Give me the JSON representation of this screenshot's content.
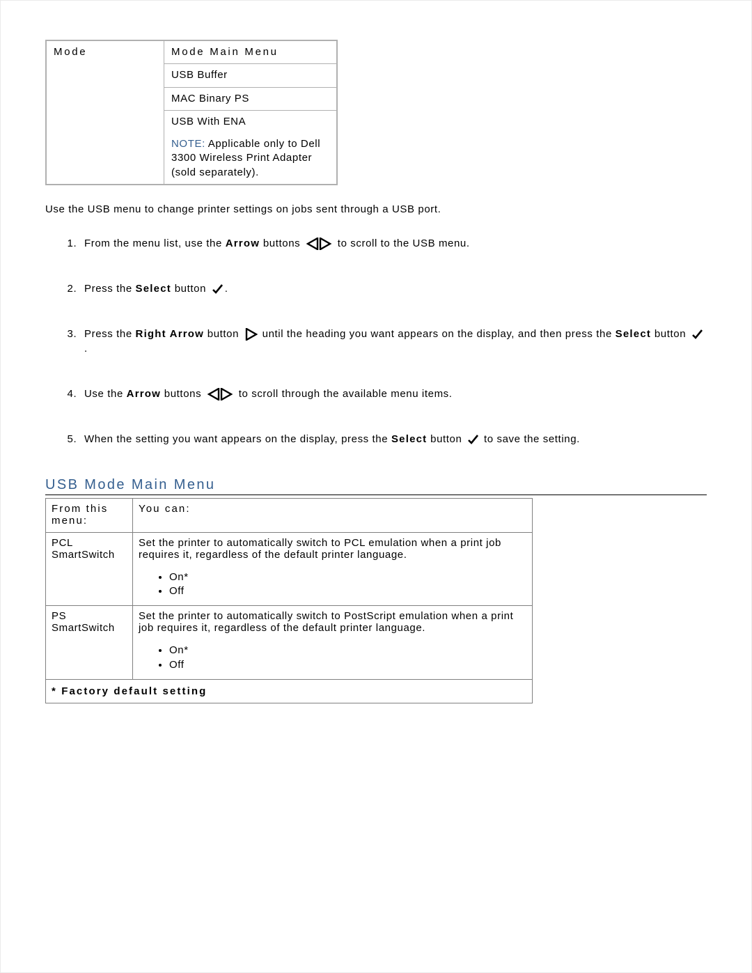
{
  "top_table": {
    "col1_header": "Mode",
    "col2_rows": {
      "r0": "Mode Main Menu",
      "r1": "USB Buffer",
      "r2": "MAC Binary PS",
      "r3_line1": "USB With ENA",
      "r3_note_label": "NOTE:",
      "r3_note_body": "  Applicable only to Dell 3300 Wireless Print Adapter (sold separately)."
    }
  },
  "intro_text": "Use the USB menu to change printer settings on jobs sent through a USB port.",
  "steps": {
    "s1_a": "From the menu list, use the ",
    "s1_bold": "Arrow",
    "s1_b": " buttons ",
    "s1_c": " to scroll to the USB menu.",
    "s2_a": "Press the ",
    "s2_bold": "Select",
    "s2_b": " button ",
    "s2_c": ".",
    "s3_a": "Press the ",
    "s3_bold": "Right Arrow",
    "s3_b": " button ",
    "s3_c": " until the heading you want appears on the display, and then press the ",
    "s3_bold2": "Select",
    "s3_d": " button ",
    "s3_e": ".",
    "s4_a": "Use the ",
    "s4_bold": "Arrow",
    "s4_b": " buttons ",
    "s4_c": " to scroll through the available menu items.",
    "s5_a": "When the setting you want appears on the display, press the ",
    "s5_bold": "Select",
    "s5_b": " button ",
    "s5_c": " to save the setting."
  },
  "section_heading": "USB Mode Main Menu",
  "menu_table": {
    "head_from": "From this menu:",
    "head_you": "You can:",
    "rows": {
      "r1_menu": "PCL SmartSwitch",
      "r1_desc": "Set the printer to automatically switch to PCL emulation when a print job requires it, regardless of the default printer language.",
      "r1_opt1": "On*",
      "r1_opt2": "Off",
      "r2_menu": "PS SmartSwitch",
      "r2_desc": "Set the printer to automatically switch to PostScript emulation when a print job requires it, regardless of the default printer language.",
      "r2_opt1": "On*",
      "r2_opt2": "Off"
    },
    "footer": "* Factory default setting"
  }
}
